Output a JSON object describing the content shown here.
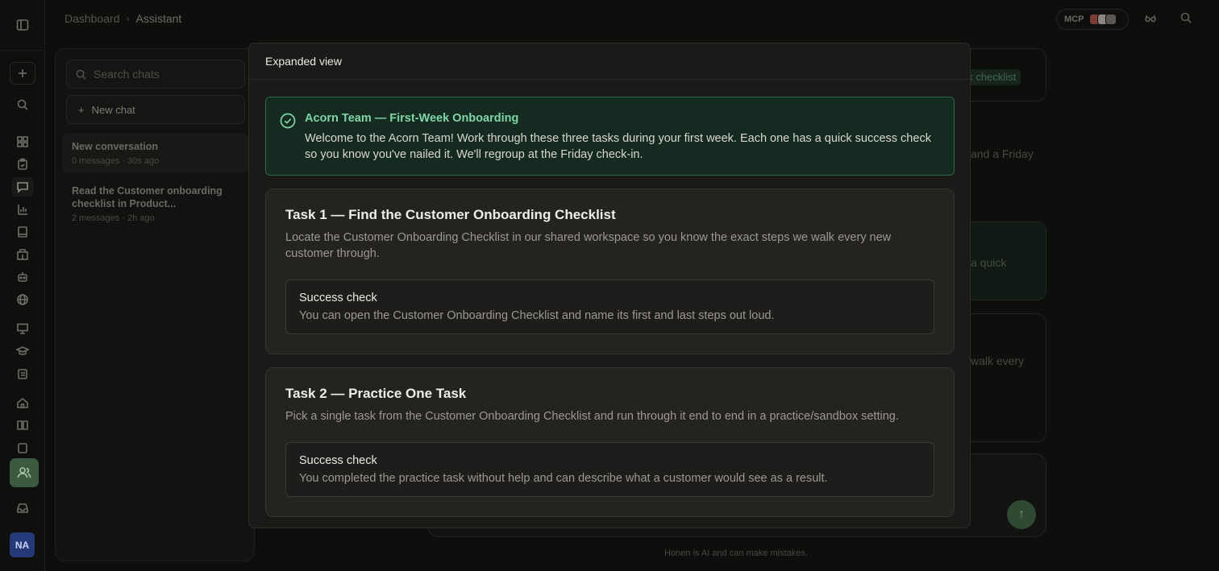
{
  "breadcrumb": {
    "root": "Dashboard",
    "current": "Assistant"
  },
  "topbar": {
    "mcp_label": "MCP",
    "icons": [
      "glasses-icon",
      "search-icon"
    ]
  },
  "rail": {
    "avatar_initials": "NA"
  },
  "chats": {
    "search_placeholder": "Search chats",
    "new_chat_label": "New chat",
    "items": [
      {
        "title": "New conversation",
        "meta": "0 messages · 30s ago"
      },
      {
        "title": "Read the Customer onboarding checklist in Product...",
        "meta": "2 messages · 2h ago"
      }
    ]
  },
  "background": {
    "chip": "ek checklist",
    "text1": "and a Friday",
    "text2": "a quick",
    "text3": "walk every",
    "disclaimer": "Honen is AI and can make mistakes."
  },
  "modal": {
    "title": "Expanded view",
    "banner": {
      "title": "Acorn Team — First-Week Onboarding",
      "body": "Welcome to the Acorn Team! Work through these three tasks during your first week. Each one has a quick success check so you know you've nailed it. We'll regroup at the Friday check-in."
    },
    "tasks": [
      {
        "title": "Task 1 — Find the Customer Onboarding Checklist",
        "description": "Locate the Customer Onboarding Checklist in our shared workspace so you know the exact steps we walk every new customer through.",
        "check_label": "Success check",
        "check_text": "You can open the Customer Onboarding Checklist and name its first and last steps out loud."
      },
      {
        "title": "Task 2 — Practice One Task",
        "description": "Pick a single task from the Customer Onboarding Checklist and run through it end to end in a practice/sandbox setting.",
        "check_label": "Success check",
        "check_text": "You completed the practice task without help and can describe what a customer would see as a result."
      }
    ]
  },
  "colors": {
    "accent_green": "#7ed6a4",
    "banner_border": "#2b6a4c",
    "avatar_bg": "#263a7a"
  }
}
